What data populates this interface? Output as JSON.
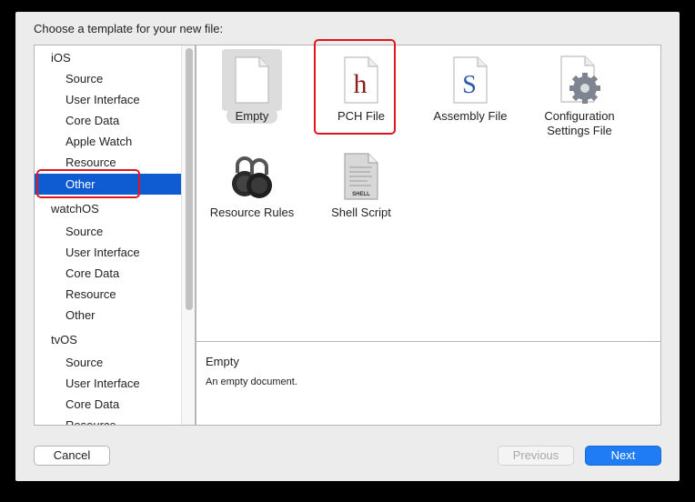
{
  "dialog": {
    "prompt": "Choose a template for your new file:"
  },
  "sidebar": {
    "groups": [
      {
        "label": "iOS",
        "items": [
          "Source",
          "User Interface",
          "Core Data",
          "Apple Watch",
          "Resource",
          "Other"
        ]
      },
      {
        "label": "watchOS",
        "items": [
          "Source",
          "User Interface",
          "Core Data",
          "Resource",
          "Other"
        ]
      },
      {
        "label": "tvOS",
        "items": [
          "Source",
          "User Interface",
          "Core Data",
          "Resource"
        ]
      }
    ],
    "selected": "iOS / Other"
  },
  "templates": [
    {
      "label": "Empty",
      "icon": "blank-document-icon",
      "selected": true
    },
    {
      "label": "PCH File",
      "icon": "header-h-document-icon",
      "glyph": "h",
      "glyph_color": "#8b1e1e"
    },
    {
      "label": "Assembly File",
      "icon": "assembly-s-document-icon",
      "glyph": "S",
      "glyph_color": "#2a5caa"
    },
    {
      "label_line1": "Configuration",
      "label_line2": "Settings File",
      "icon": "gear-document-icon"
    },
    {
      "label": "Resource Rules",
      "icon": "padlocks-icon"
    },
    {
      "label": "Shell Script",
      "icon": "shell-script-document-icon",
      "badge": "SHELL"
    }
  ],
  "description": {
    "title": "Empty",
    "text": "An empty document."
  },
  "buttons": {
    "cancel": "Cancel",
    "previous": "Previous",
    "next": "Next"
  },
  "colors": {
    "selection": "#0f5bd2",
    "next_button": "#1f7cf5",
    "highlight": "#e0161e"
  }
}
